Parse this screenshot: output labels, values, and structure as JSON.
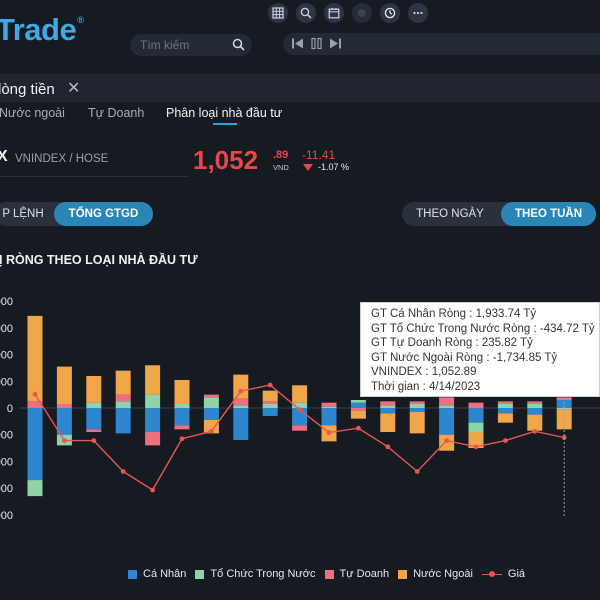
{
  "app": {
    "logo_text": "Trade",
    "logo_mark": "®"
  },
  "search": {
    "placeholder": "Tìm kiếm"
  },
  "toolbar_icons": [
    "table-icon",
    "search-chart-icon",
    "calendar-icon",
    "coin-icon",
    "clock-icon",
    "more-icon"
  ],
  "panel": {
    "title": "lòng tiền",
    "close": "✕"
  },
  "subtabs": [
    "Nước ngoài",
    "Tự Doanh",
    "Phân loại nhà đầu tư"
  ],
  "index": {
    "code": "X",
    "name": "VNINDEX / HOSE",
    "price": "1,052",
    "decimals": ".89",
    "unit": "VND",
    "change": "-11.41",
    "change_pct": "-1.07 %"
  },
  "value_toggle": {
    "left": "P LỆNH",
    "right": "TỔNG GTGD"
  },
  "period_toggle": {
    "left": "THEO NGÀY",
    "right": "THEO TUẦN"
  },
  "chart_title": "Ị RÒNG THEO LOẠI NHÀ ĐẦU TƯ",
  "colors": {
    "ca_nhan": "#2e86d1",
    "to_chuc": "#8fd3a8",
    "tu_doanh": "#ee6f80",
    "nuoc_ngoai": "#f2a64a",
    "gia": "#e85654",
    "accent": "#2a86b6"
  },
  "tooltip": {
    "lines": [
      "GT Cá Nhân Ròng  : 1,933.74 Tỷ",
      "GT Tổ Chức Trong Nước Ròng : -434.72 Tỷ",
      "GT Tự Doanh Ròng : 235.82 Tỷ",
      "GT Nước Ngoài Ròng : -1,734.85 Tỷ",
      "VNINDEX : 1,052.89",
      "Thời gian : 4/14/2023"
    ]
  },
  "chart_data": {
    "type": "bar",
    "stacked": true,
    "ylim": [
      -4000,
      4000
    ],
    "y_ticks": [
      {
        "value": 4000,
        "label": "000"
      },
      {
        "value": 3000,
        "label": "000"
      },
      {
        "value": 2000,
        "label": "000"
      },
      {
        "value": 1000,
        "label": "000"
      },
      {
        "value": 0,
        "label": "0"
      },
      {
        "value": -1000,
        "label": "000"
      },
      {
        "value": -2000,
        "label": "000"
      },
      {
        "value": -3000,
        "label": "000"
      },
      {
        "value": -4000,
        "label": "000"
      }
    ],
    "series": [
      {
        "name": "Cá Nhân",
        "values": [
          -2700,
          -1000,
          -800,
          -950,
          -900,
          -650,
          -450,
          -1200,
          -300,
          -650,
          -650,
          200,
          -200,
          -150,
          -1000,
          -550,
          -200,
          -250,
          300
        ]
      },
      {
        "name": "Tổ Chức Trong Nước",
        "values": [
          -600,
          -400,
          200,
          250,
          500,
          150,
          400,
          100,
          150,
          200,
          50,
          100,
          100,
          150,
          100,
          -350,
          150,
          150,
          -50
        ]
      },
      {
        "name": "Tự Doanh",
        "values": [
          250,
          150,
          -100,
          250,
          -500,
          -150,
          100,
          250,
          100,
          -200,
          150,
          -100,
          150,
          100,
          300,
          200,
          100,
          100,
          100
        ]
      },
      {
        "name": "Nước Ngoài",
        "values": [
          3200,
          1400,
          1000,
          900,
          1100,
          900,
          -500,
          900,
          400,
          650,
          -600,
          -300,
          -700,
          -800,
          -600,
          -600,
          -350,
          -600,
          -750
        ]
      }
    ],
    "line": {
      "name": "Giá",
      "values": [
        1060,
        985,
        985,
        935,
        905,
        988,
        1000,
        1065,
        1075,
        1035,
        998,
        1005,
        975,
        935,
        985,
        975,
        985,
        1000,
        990
      ]
    }
  },
  "legend": [
    "Cá Nhân",
    "Tổ Chức Trong Nước",
    "Tự Doanh",
    "Nước Ngoài",
    "Giá"
  ]
}
